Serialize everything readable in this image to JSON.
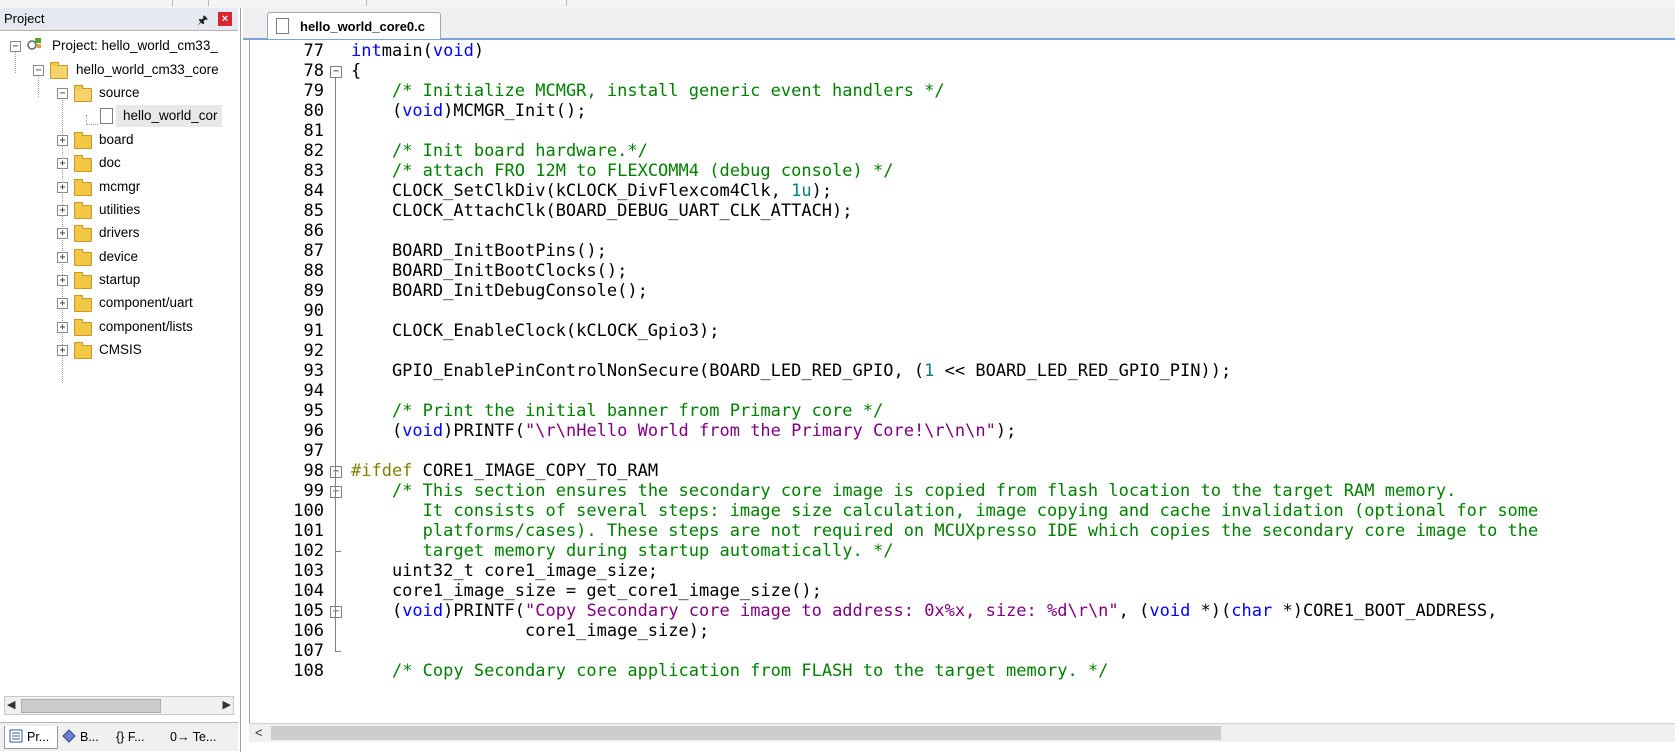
{
  "project_panel": {
    "title": "Project",
    "pin_icon": "pin-icon",
    "close_icon": "close-icon",
    "tree": [
      {
        "label": "Project: hello_world_cm33_",
        "icon": "project-icon",
        "expanded": true
      },
      {
        "label": "hello_world_cm33_core",
        "icon": "target-folder-icon",
        "expanded": true
      },
      {
        "label": "source",
        "icon": "folder-open-icon",
        "expanded": true
      },
      {
        "label": "hello_world_cor",
        "icon": "file-icon",
        "selected": true
      },
      {
        "label": "board",
        "icon": "folder-icon"
      },
      {
        "label": "doc",
        "icon": "folder-icon"
      },
      {
        "label": "mcmgr",
        "icon": "folder-icon"
      },
      {
        "label": "utilities",
        "icon": "folder-icon"
      },
      {
        "label": "drivers",
        "icon": "folder-icon"
      },
      {
        "label": "device",
        "icon": "folder-icon"
      },
      {
        "label": "startup",
        "icon": "folder-icon"
      },
      {
        "label": "component/uart",
        "icon": "folder-icon"
      },
      {
        "label": "component/lists",
        "icon": "folder-icon"
      },
      {
        "label": "CMSIS",
        "icon": "folder-icon"
      }
    ],
    "bottom_tabs": [
      {
        "label": "Pr...",
        "icon": "project-tab-icon",
        "active": true
      },
      {
        "label": "B...",
        "icon": "books-icon"
      },
      {
        "label": "{} F...",
        "icon": "functions-icon"
      },
      {
        "label": "0→ Te...",
        "icon": "templates-icon"
      }
    ]
  },
  "editor": {
    "tab_label": "hello_world_core0.c",
    "lines": [
      {
        "n": "77",
        "fold": "",
        "parts": [
          [
            "kw",
            "int"
          ],
          [
            "",
            "main("
          ],
          [
            "kw",
            "void"
          ],
          [
            "",
            ")"
          ]
        ]
      },
      {
        "n": "78",
        "fold": "box",
        "parts": [
          [
            "",
            "{"
          ]
        ]
      },
      {
        "n": "79",
        "fold": "",
        "parts": [
          [
            "",
            "    "
          ],
          [
            "cm",
            "/* Initialize MCMGR, install generic event handlers */"
          ]
        ]
      },
      {
        "n": "80",
        "fold": "",
        "parts": [
          [
            "",
            "    ("
          ],
          [
            "kw",
            "void"
          ],
          [
            "",
            ")MCMGR_Init();"
          ]
        ]
      },
      {
        "n": "81",
        "fold": "",
        "parts": [
          [
            "",
            ""
          ]
        ]
      },
      {
        "n": "82",
        "fold": "",
        "parts": [
          [
            "",
            "    "
          ],
          [
            "cm",
            "/* Init board hardware.*/"
          ]
        ]
      },
      {
        "n": "83",
        "fold": "",
        "parts": [
          [
            "",
            "    "
          ],
          [
            "cm",
            "/* attach FRO 12M to FLEXCOMM4 (debug console) */"
          ]
        ]
      },
      {
        "n": "84",
        "fold": "",
        "parts": [
          [
            "",
            "    CLOCK_SetClkDiv(kCLOCK_DivFlexcom4Clk, "
          ],
          [
            "nm",
            "1u"
          ],
          [
            "",
            ");"
          ]
        ]
      },
      {
        "n": "85",
        "fold": "",
        "parts": [
          [
            "",
            "    CLOCK_AttachClk(BOARD_DEBUG_UART_CLK_ATTACH);"
          ]
        ]
      },
      {
        "n": "86",
        "fold": "",
        "parts": [
          [
            "",
            ""
          ]
        ]
      },
      {
        "n": "87",
        "fold": "",
        "parts": [
          [
            "",
            "    BOARD_InitBootPins();"
          ]
        ]
      },
      {
        "n": "88",
        "fold": "",
        "parts": [
          [
            "",
            "    BOARD_InitBootClocks();"
          ]
        ]
      },
      {
        "n": "89",
        "fold": "",
        "parts": [
          [
            "",
            "    BOARD_InitDebugConsole();"
          ]
        ]
      },
      {
        "n": "90",
        "fold": "",
        "parts": [
          [
            "",
            ""
          ]
        ]
      },
      {
        "n": "91",
        "fold": "",
        "parts": [
          [
            "",
            "    CLOCK_EnableClock(kCLOCK_Gpio3);"
          ]
        ]
      },
      {
        "n": "92",
        "fold": "",
        "parts": [
          [
            "",
            ""
          ]
        ]
      },
      {
        "n": "93",
        "fold": "",
        "parts": [
          [
            "",
            "    GPIO_EnablePinControlNonSecure(BOARD_LED_RED_GPIO, ("
          ],
          [
            "nm",
            "1"
          ],
          [
            "",
            " << BOARD_LED_RED_GPIO_PIN));"
          ]
        ]
      },
      {
        "n": "94",
        "fold": "",
        "parts": [
          [
            "",
            ""
          ]
        ]
      },
      {
        "n": "95",
        "fold": "",
        "parts": [
          [
            "",
            "    "
          ],
          [
            "cm",
            "/* Print the initial banner from Primary core */"
          ]
        ]
      },
      {
        "n": "96",
        "fold": "",
        "parts": [
          [
            "",
            "    ("
          ],
          [
            "kw",
            "void"
          ],
          [
            "",
            ")PRINTF("
          ],
          [
            "st",
            "\"\\r\\nHello World from the Primary Core!\\r\\n\\n\""
          ],
          [
            "",
            ");"
          ]
        ]
      },
      {
        "n": "97",
        "fold": "",
        "parts": [
          [
            "",
            ""
          ]
        ]
      },
      {
        "n": "98",
        "fold": "box",
        "parts": [
          [
            "pp",
            "#ifdef"
          ],
          [
            "",
            " CORE1_IMAGE_COPY_TO_RAM"
          ]
        ]
      },
      {
        "n": "99",
        "fold": "box",
        "parts": [
          [
            "",
            "    "
          ],
          [
            "cm",
            "/* This section ensures the secondary core image is copied from flash location to the target RAM memory."
          ]
        ]
      },
      {
        "n": "100",
        "fold": "",
        "parts": [
          [
            "",
            "       "
          ],
          [
            "cm",
            "It consists of several steps: image size calculation, image copying and cache invalidation (optional for some"
          ]
        ]
      },
      {
        "n": "101",
        "fold": "",
        "parts": [
          [
            "",
            "       "
          ],
          [
            "cm",
            "platforms/cases). These steps are not required on MCUXpresso IDE which copies the secondary core image to the"
          ]
        ]
      },
      {
        "n": "102",
        "fold": "end",
        "parts": [
          [
            "",
            "       "
          ],
          [
            "cm",
            "target memory during startup automatically. */"
          ]
        ]
      },
      {
        "n": "103",
        "fold": "",
        "parts": [
          [
            "",
            "    uint32_t core1_image_size;"
          ]
        ]
      },
      {
        "n": "104",
        "fold": "",
        "parts": [
          [
            "",
            "    core1_image_size = get_core1_image_size();"
          ]
        ]
      },
      {
        "n": "105",
        "fold": "box",
        "parts": [
          [
            "",
            "    ("
          ],
          [
            "kw",
            "void"
          ],
          [
            "",
            ")PRINTF("
          ],
          [
            "st",
            "\"Copy Secondary core image to address: 0x%x, size: %d\\r\\n\""
          ],
          [
            "",
            ", ("
          ],
          [
            "kw",
            "void"
          ],
          [
            "",
            " *)("
          ],
          [
            "kw",
            "char"
          ],
          [
            "",
            " *)CORE1_BOOT_ADDRESS,"
          ]
        ]
      },
      {
        "n": "106",
        "fold": "",
        "parts": [
          [
            "",
            "                 core1_image_size);"
          ]
        ]
      },
      {
        "n": "107",
        "fold": "end",
        "parts": [
          [
            "",
            ""
          ]
        ]
      },
      {
        "n": "108",
        "fold": "",
        "parts": [
          [
            "",
            "    "
          ],
          [
            "cm",
            "/* Copy Secondary core application from FLASH to the target memory. */"
          ]
        ]
      }
    ]
  }
}
